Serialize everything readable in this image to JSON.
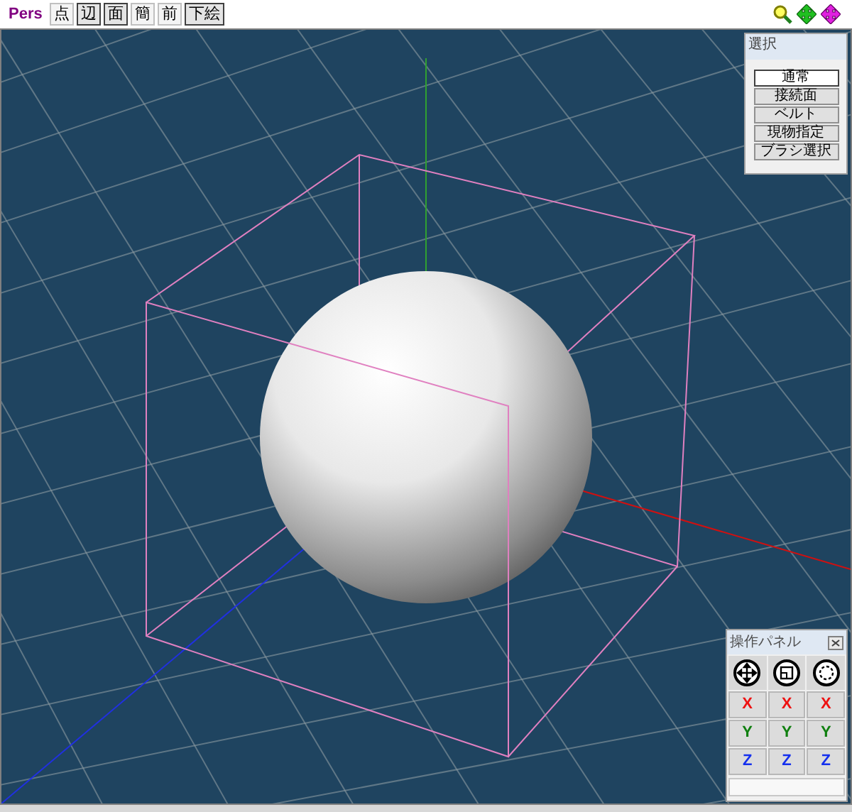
{
  "view_mode": "Pers",
  "toolbar_buttons": [
    {
      "label": "点",
      "selected": false
    },
    {
      "label": "辺",
      "selected": true
    },
    {
      "label": "面",
      "selected": true
    },
    {
      "label": "簡",
      "selected": false
    },
    {
      "label": "前",
      "selected": false
    },
    {
      "label": "下絵",
      "selected": true
    }
  ],
  "selection_panel": {
    "title": "選択",
    "buttons": [
      {
        "label": "通常",
        "selected": true
      },
      {
        "label": "接続面",
        "selected": false
      },
      {
        "label": "ベルト",
        "selected": false
      },
      {
        "label": "現物指定",
        "selected": false
      },
      {
        "label": "ブラシ選択",
        "selected": false
      }
    ]
  },
  "operation_panel": {
    "title": "操作パネル",
    "axis_rows": [
      {
        "labels": [
          "X",
          "X",
          "X"
        ],
        "color": "#ee1111"
      },
      {
        "labels": [
          "Y",
          "Y",
          "Y"
        ],
        "color": "#108010"
      },
      {
        "labels": [
          "Z",
          "Z",
          "Z"
        ],
        "color": "#1530ee"
      }
    ]
  }
}
